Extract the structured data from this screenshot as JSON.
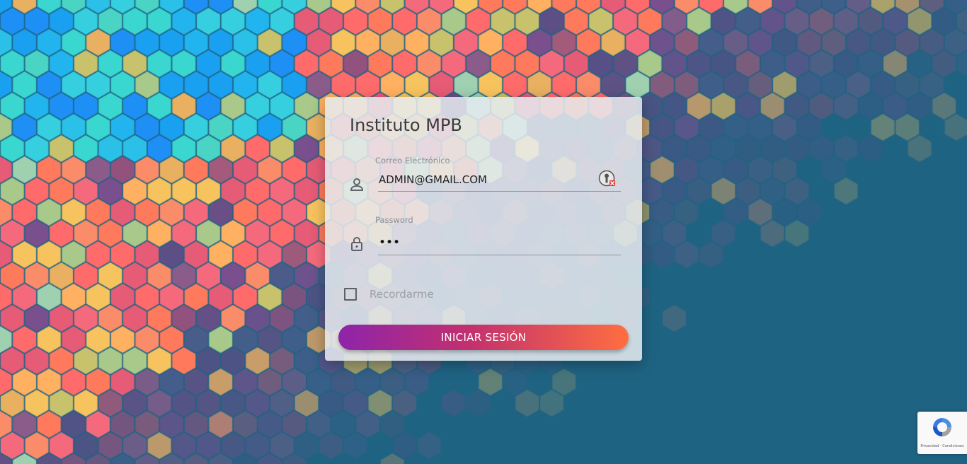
{
  "background": {
    "base_color": "#1f6383"
  },
  "login_card": {
    "title": "Instituto MPB",
    "email": {
      "label": "Correo Electrónico",
      "value": "ADMIN@GMAIL.COM",
      "icon": "person-icon"
    },
    "password": {
      "label": "Password",
      "value": "•••",
      "icon": "lock-icon"
    },
    "remember_me": {
      "label": "Recordarme",
      "checked": false
    },
    "submit_label": "INICIAR SESIÓN",
    "button_gradient": [
      "#8e24aa",
      "#ff6e40"
    ]
  },
  "recaptcha": {
    "footer_text": "Privacidad - Condiciones",
    "icon": "recaptcha-icon"
  }
}
